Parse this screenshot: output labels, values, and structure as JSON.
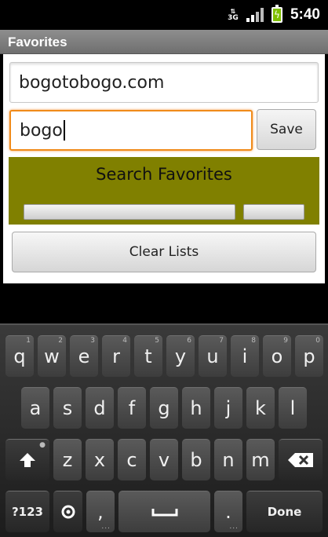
{
  "status": {
    "network": "3G",
    "time": "5:40"
  },
  "app": {
    "title": "Favorites"
  },
  "form": {
    "url_value": "bogotobogo.com",
    "tag_value": "bogo",
    "save_label": "Save",
    "search_title": "Search Favorites",
    "clear_label": "Clear Lists"
  },
  "keyboard": {
    "row1": [
      {
        "key": "q",
        "num": "1"
      },
      {
        "key": "w",
        "num": "2"
      },
      {
        "key": "e",
        "num": "3"
      },
      {
        "key": "r",
        "num": "4"
      },
      {
        "key": "t",
        "num": "5"
      },
      {
        "key": "y",
        "num": "6"
      },
      {
        "key": "u",
        "num": "7"
      },
      {
        "key": "i",
        "num": "8"
      },
      {
        "key": "o",
        "num": "9"
      },
      {
        "key": "p",
        "num": "0"
      }
    ],
    "row2": [
      "a",
      "s",
      "d",
      "f",
      "g",
      "h",
      "j",
      "k",
      "l"
    ],
    "row3": [
      "z",
      "x",
      "c",
      "v",
      "b",
      "n",
      "m"
    ],
    "symbols_label": "?123",
    "comma_label": ",",
    "period_label": ".",
    "done_label": "Done"
  },
  "colors": {
    "accent_focus": "#f08b1a",
    "search_panel": "#808000"
  }
}
